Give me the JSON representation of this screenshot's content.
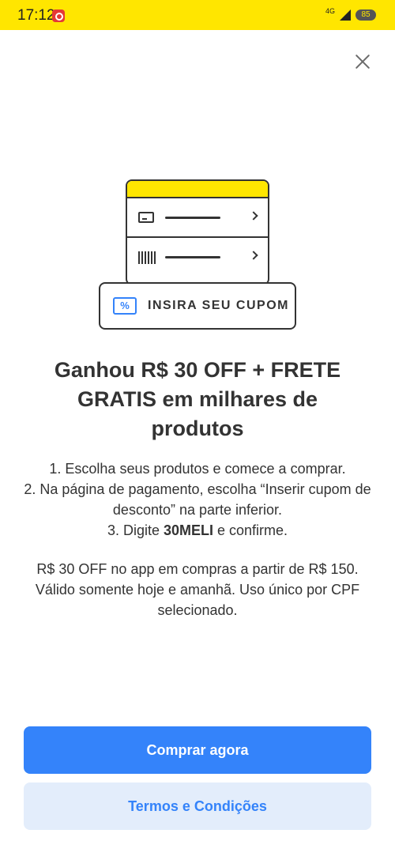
{
  "status_bar": {
    "time": "17:12",
    "network": "4G",
    "battery": "85",
    "background_color": "#ffe600"
  },
  "modal": {
    "close_icon": "close-icon",
    "illustration": {
      "coupon_label": "INSIRA SEU CUPOM",
      "coupon_icon_glyph": "%",
      "row_icons": [
        "credit-card-icon",
        "barcode-icon"
      ]
    },
    "headline": "Ganhou R$ 30 OFF + FRETE GRATIS em milhares de produtos",
    "steps": {
      "step1": "1. Escolha seus produtos e comece a comprar.",
      "step2": "2. Na página de pagamento, escolha “Inserir cupom de desconto” na parte inferior.",
      "step3_prefix": "3. Digite ",
      "step3_code": "30MELI",
      "step3_suffix": " e confirme."
    },
    "conditions": "R$ 30 OFF no app em compras a partir de R$ 150. Válido somente hoje e amanhã. Uso único por CPF selecionado.",
    "primary_button": "Comprar agora",
    "secondary_button": "Termos e Condições"
  },
  "colors": {
    "accent": "#3483fa",
    "brand_yellow": "#ffe600",
    "secondary_button_bg": "#e3edfb",
    "text": "#333333"
  }
}
